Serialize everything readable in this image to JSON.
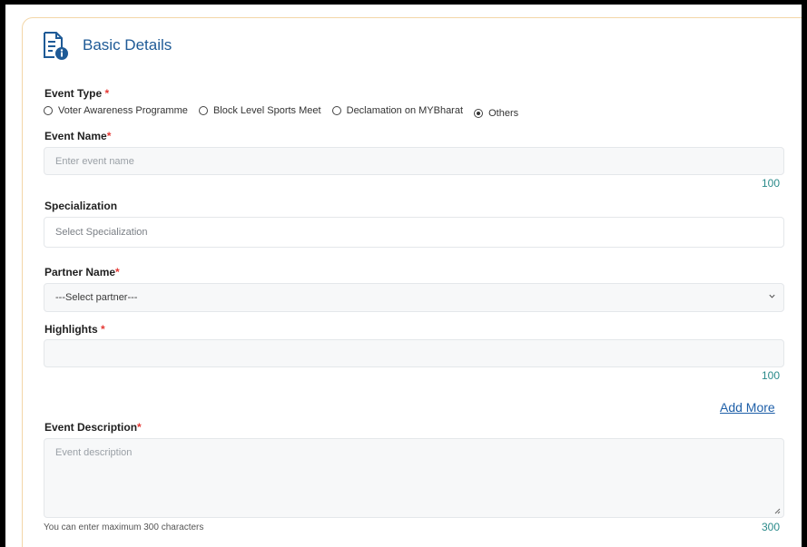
{
  "section": {
    "title": "Basic Details",
    "icon": "document-info-icon"
  },
  "event_type": {
    "label": "Event Type",
    "required_mark": "*",
    "options": [
      {
        "label": "Voter Awareness Programme",
        "selected": false
      },
      {
        "label": "Block Level Sports Meet",
        "selected": false
      },
      {
        "label": "Declamation on MYBharat",
        "selected": false
      },
      {
        "label": "Others",
        "selected": true
      }
    ]
  },
  "event_name": {
    "label": "Event Name",
    "required_mark": "*",
    "placeholder": "Enter event name",
    "counter": "100"
  },
  "specialization": {
    "label": "Specialization",
    "placeholder": "Select Specialization"
  },
  "partner_name": {
    "label": "Partner Name",
    "required_mark": "*",
    "selected": "---Select partner---"
  },
  "highlights": {
    "label": "Highlights",
    "required_mark": "*",
    "value": "",
    "counter": "100",
    "add_more": "Add More"
  },
  "event_description": {
    "label": "Event Description",
    "required_mark": "*",
    "placeholder": "Event description",
    "hint": "You can enter maximum 300 characters",
    "counter": "300"
  },
  "colors": {
    "accent": "#1e5a96",
    "required": "#e53935",
    "counter": "#2a8a8a",
    "card_border": "#f3d6a8"
  }
}
